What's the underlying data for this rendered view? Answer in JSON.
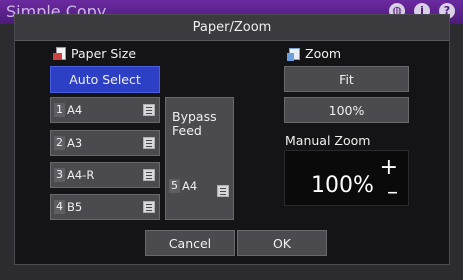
{
  "app": {
    "title": "Simple Copy",
    "icons": [
      "globe-icon",
      "info-icon",
      "help-icon"
    ]
  },
  "dialog": {
    "title": "Paper/Zoom",
    "paper_size": {
      "label": "Paper Size",
      "auto_select": "Auto Select",
      "trays": [
        {
          "number": "1",
          "size": "A4"
        },
        {
          "number": "2",
          "size": "A3"
        },
        {
          "number": "3",
          "size": "A4-R"
        },
        {
          "number": "4",
          "size": "B5"
        }
      ],
      "bypass": {
        "label_line1": "Bypass",
        "label_line2": "Feed",
        "number": "5",
        "size": "A4"
      }
    },
    "zoom": {
      "label": "Zoom",
      "fit": "Fit",
      "hundred": "100%",
      "manual_label": "Manual Zoom",
      "value": "100%",
      "plus": "+",
      "minus": "–"
    },
    "cancel": "Cancel",
    "ok": "OK"
  },
  "colors": {
    "selected_button": "#2d3fc4",
    "button": "#4a4a4f",
    "header": "#4c1b78"
  }
}
